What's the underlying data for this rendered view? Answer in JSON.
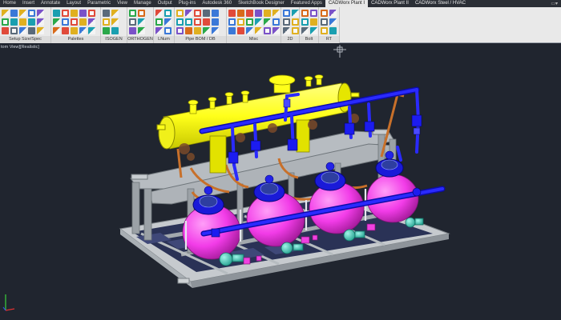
{
  "tabs": [
    "Home",
    "Insert",
    "Annotate",
    "Layout",
    "Parametric",
    "View",
    "Manage",
    "Output",
    "Plug-ins",
    "Autodesk 360",
    "SketchBook Designer",
    "Featured Apps",
    "CADWorx Plant I",
    "CADWorx Plant II",
    "CADWorx Steel / HVAC"
  ],
  "active_tab": "CADWorx Plant I",
  "panels": [
    "Setup Size/Spec",
    "Palettes",
    "ISOGEN",
    "ORTHOGEN",
    "LNum",
    "Pipe BOM / DB",
    "Misc",
    "2D",
    "Bolt",
    "RT"
  ],
  "viewport_label": "tom View][Realistic]",
  "colors": {
    "background": "#20252f",
    "vessel": "#ffff1a",
    "pipe_blue": "#1414e0",
    "tank_magenta": "#f23ce8",
    "pump_teal": "#33d6c0",
    "skid_grey": "#bfc4c8",
    "copper": "#c8702a"
  }
}
